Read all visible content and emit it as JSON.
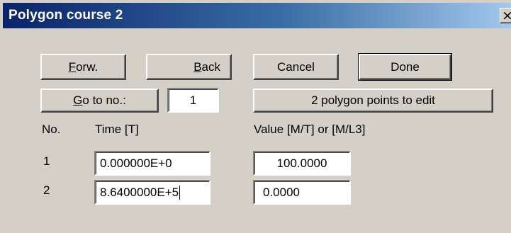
{
  "window": {
    "title": "Polygon course 2",
    "close_glyph": "×"
  },
  "buttons": {
    "forward": {
      "mnemonic": "F",
      "rest": "orw."
    },
    "back": {
      "mnemonic": "B",
      "rest": "ack"
    },
    "cancel": "Cancel",
    "done": "Done",
    "goto": {
      "mnemonic": "G",
      "rest": "o to no.:"
    },
    "points_to_edit": "2 polygon points to edit"
  },
  "goto_value": "1",
  "table": {
    "headers": {
      "no": "No.",
      "time": "Time [T]",
      "value": "Value [M/T] or [M/L3]"
    },
    "rows": [
      {
        "no": "1",
        "time": "0.000000E+0",
        "value": "100.0000"
      },
      {
        "no": "2",
        "time": "8.6400000E+5",
        "value": "0.0000"
      }
    ]
  }
}
